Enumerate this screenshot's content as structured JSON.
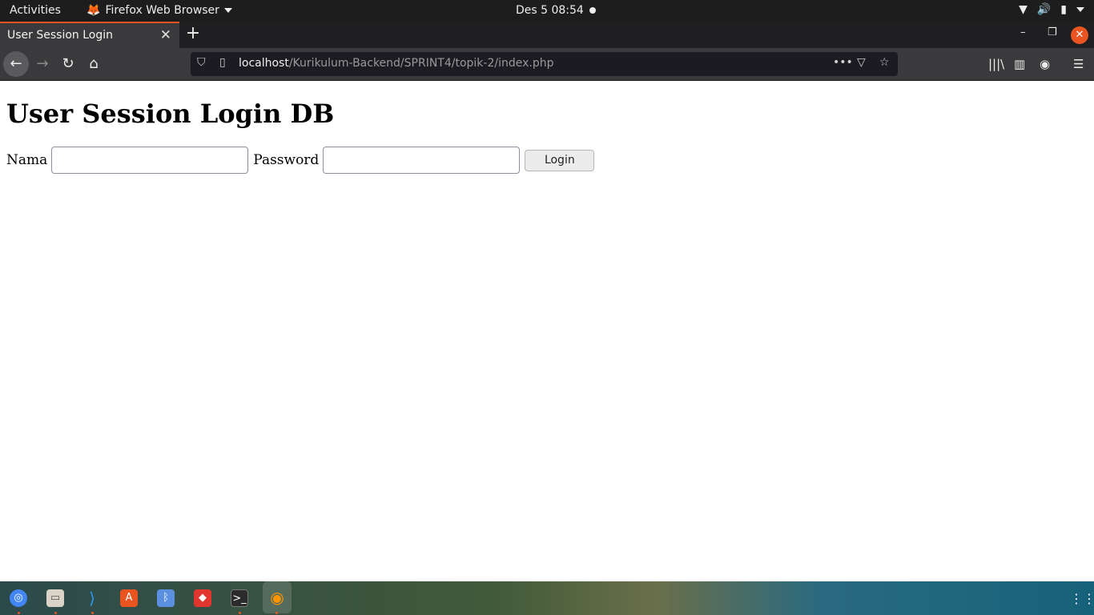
{
  "system_bar": {
    "activities": "Activities",
    "app_name": "Firefox Web Browser",
    "clock": "Des 5  08:54"
  },
  "browser": {
    "tab_title": "User Session Login",
    "url_host": "localhost",
    "url_path": "/Kurikulum-Backend/SPRINT4/topik-2/index.php"
  },
  "page": {
    "heading": "User Session Login DB",
    "nama_label": "Nama",
    "nama_value": "",
    "password_label": "Password",
    "password_value": "",
    "login_label": "Login"
  },
  "colors": {
    "accent": "#e95420",
    "chrome_dark": "#1f1f21",
    "toolbar": "#3a3a3c"
  },
  "dock": {
    "icons": [
      "chrome-icon",
      "files-icon",
      "vscode-icon",
      "software-center-icon",
      "bluetooth-icon",
      "anydesk-icon",
      "terminal-icon",
      "firefox-icon"
    ]
  }
}
